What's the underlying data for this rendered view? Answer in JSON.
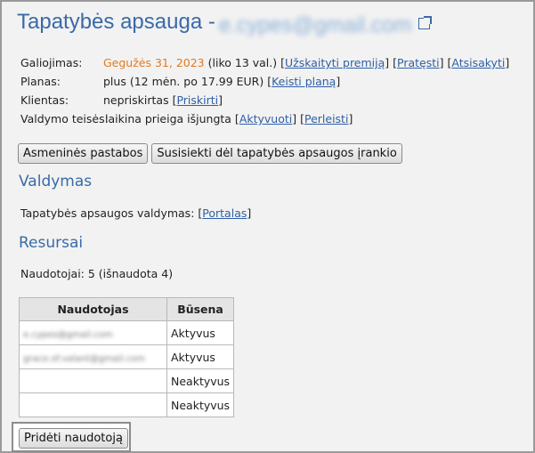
{
  "header": {
    "title": "Tapatybės apsauga -",
    "email_blurred": "e.cypes@gmail.com",
    "external_icon": "external-link-icon"
  },
  "info": {
    "validity": {
      "label": "Galiojimas:",
      "date": "Gegužės 31, 2023",
      "remaining": "(liko 13 val.)",
      "links": [
        "Užskaityti premiją",
        "Pratęsti",
        "Atsisakyti"
      ]
    },
    "plan": {
      "label": "Planas:",
      "value": "plus (12 mėn. po 17.99 EUR)",
      "link": "Keisti planą"
    },
    "client": {
      "label": "Klientas:",
      "value": "nepriskirtas",
      "link": "Priskirti"
    },
    "admin": {
      "label": "Valdymo teisės:",
      "value": "laikina prieiga išjungta",
      "links": [
        "Aktyvuoti",
        "Perleisti"
      ]
    }
  },
  "buttons": {
    "notes": "Asmeninės pastabos",
    "connect": "Susisiekti dėl tapatybės apsaugos įrankio"
  },
  "management": {
    "heading": "Valdymas",
    "label": "Tapatybės apsaugos valdymas:",
    "link": "Portalas"
  },
  "resources": {
    "heading": "Resursai",
    "users_count": "Naudotojai: 5 (išnaudota 4)"
  },
  "users_table": {
    "headers": [
      "Naudotojas",
      "Būsena"
    ],
    "rows": [
      {
        "user": "e.cypes@gmail.com",
        "status": "Aktyvus"
      },
      {
        "user": "grace.of.valant@gmail.com",
        "status": "Aktyvus"
      },
      {
        "user": "",
        "status": "Neaktyvus"
      },
      {
        "user": "",
        "status": "Neaktyvus"
      }
    ]
  },
  "add_user_button": "Pridėti naudotoją",
  "colors": {
    "heading": "#3a6aa8",
    "link": "#2f5fa6",
    "date": "#e07a1f",
    "background": "#f2f2f2"
  }
}
